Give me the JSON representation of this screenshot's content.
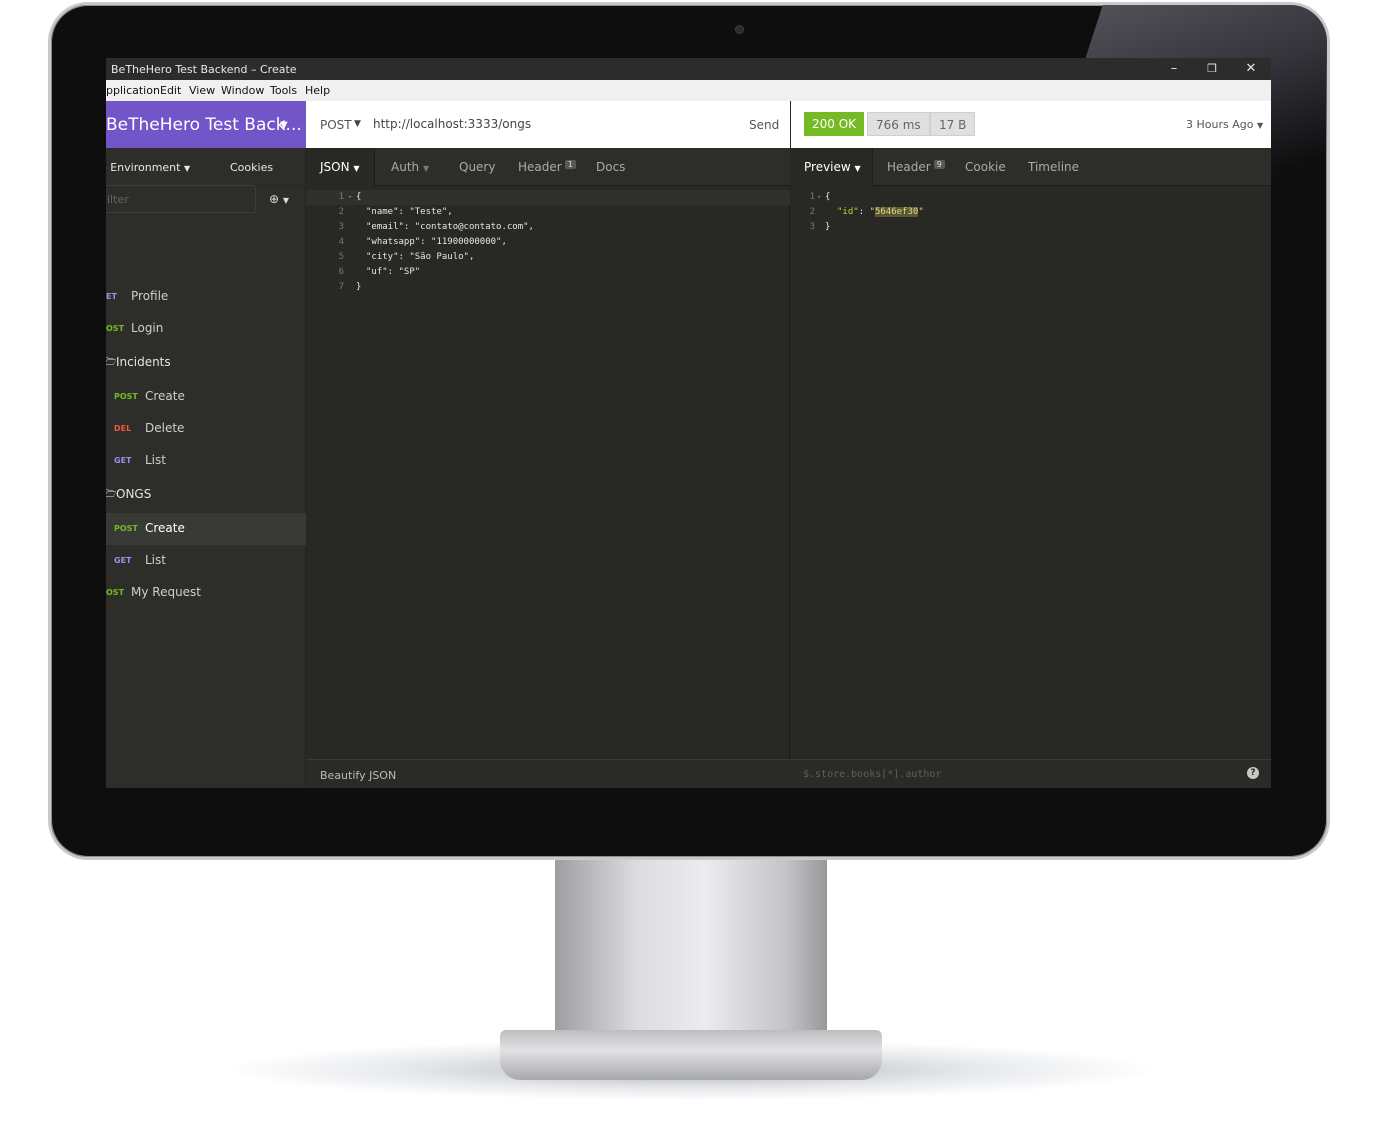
{
  "window": {
    "title": "BeTheHero Test Backend – Create",
    "minimize": "–",
    "restore": "❐",
    "close": "✕"
  },
  "menu": [
    "pplication",
    "Edit",
    "View",
    "Window",
    "Tools",
    "Help"
  ],
  "sidebar": {
    "workspace": "BeTheHero Test Back...",
    "environment": "o Environment",
    "cookies": "Cookies",
    "filter_placeholder": "ilter",
    "items": [
      {
        "method": "ET",
        "label": "Profile",
        "method_color": "#9d8cf2"
      },
      {
        "method": "OST",
        "label": "Login",
        "method_color": "#75ba24"
      },
      {
        "folder": true,
        "label": "Incidents"
      },
      {
        "method": "POST",
        "label": "Create",
        "method_color": "#75ba24"
      },
      {
        "method": "DEL",
        "label": "Delete",
        "method_color": "#ec5a3a"
      },
      {
        "method": "GET",
        "label": "List",
        "method_color": "#9d8cf2"
      },
      {
        "folder": true,
        "label": "ONGS"
      },
      {
        "method": "POST",
        "label": "Create",
        "method_color": "#75ba24",
        "active": true
      },
      {
        "method": "GET",
        "label": "List",
        "method_color": "#9d8cf2"
      },
      {
        "method": "OST",
        "label": "My Request",
        "method_color": "#75ba24"
      }
    ]
  },
  "request": {
    "method": "POST",
    "url": "http://localhost:3333/ongs",
    "send": "Send",
    "tabs": {
      "json": "JSON",
      "auth": "Auth",
      "query": "Query",
      "header": "Header",
      "header_count": "1",
      "docs": "Docs"
    },
    "body_lines": [
      "{",
      "\"name\": \"Teste\",",
      "\"email\": \"contato@contato.com\",",
      "\"whatsapp\": \"11900000000\",",
      "\"city\": \"São Paulo\",",
      "\"uf\": \"SP\"",
      "}"
    ],
    "footer": "Beautify JSON"
  },
  "response": {
    "status": "200 OK",
    "time": "766 ms",
    "size": "17 B",
    "ago": "3 Hours Ago",
    "tabs": {
      "preview": "Preview",
      "header": "Header",
      "header_count": "9",
      "cookie": "Cookie",
      "timeline": "Timeline"
    },
    "body": {
      "id_key": "\"id\"",
      "id_value": "5646ef30"
    },
    "filter_placeholder": "$.store.books[*].author",
    "help": "?"
  },
  "colors": {
    "accent": "#7255c9",
    "ok": "#75ba24",
    "editor_bg": "#282925"
  }
}
